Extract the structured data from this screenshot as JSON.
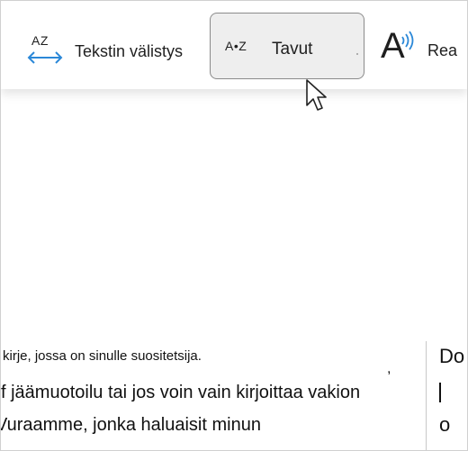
{
  "toolbar": {
    "text_spacing": {
      "icon_text": "AZ",
      "label": "Tekstin välistys",
      "icon": "text-spacing-icon"
    },
    "syllables": {
      "icon_text": "A•Z",
      "label": "Tavut",
      "icon": "syllables-icon"
    },
    "read_aloud": {
      "label": "Rea",
      "icon": "read-aloud-icon"
    }
  },
  "document": {
    "lines": [
      "kirje, jossa on sinulle suositetsija.",
      "f jäämuotoilu tai jos voin vain kirjoittaa vakion",
      "Vuraamme, jonka haluaisit minun"
    ],
    "right_column": {
      "top": "Do",
      "bottom": "o"
    }
  },
  "colors": {
    "accent_blue": "#2b88d8",
    "selected_bg": "#eeeeee",
    "selected_border": "#8a8a8a"
  }
}
